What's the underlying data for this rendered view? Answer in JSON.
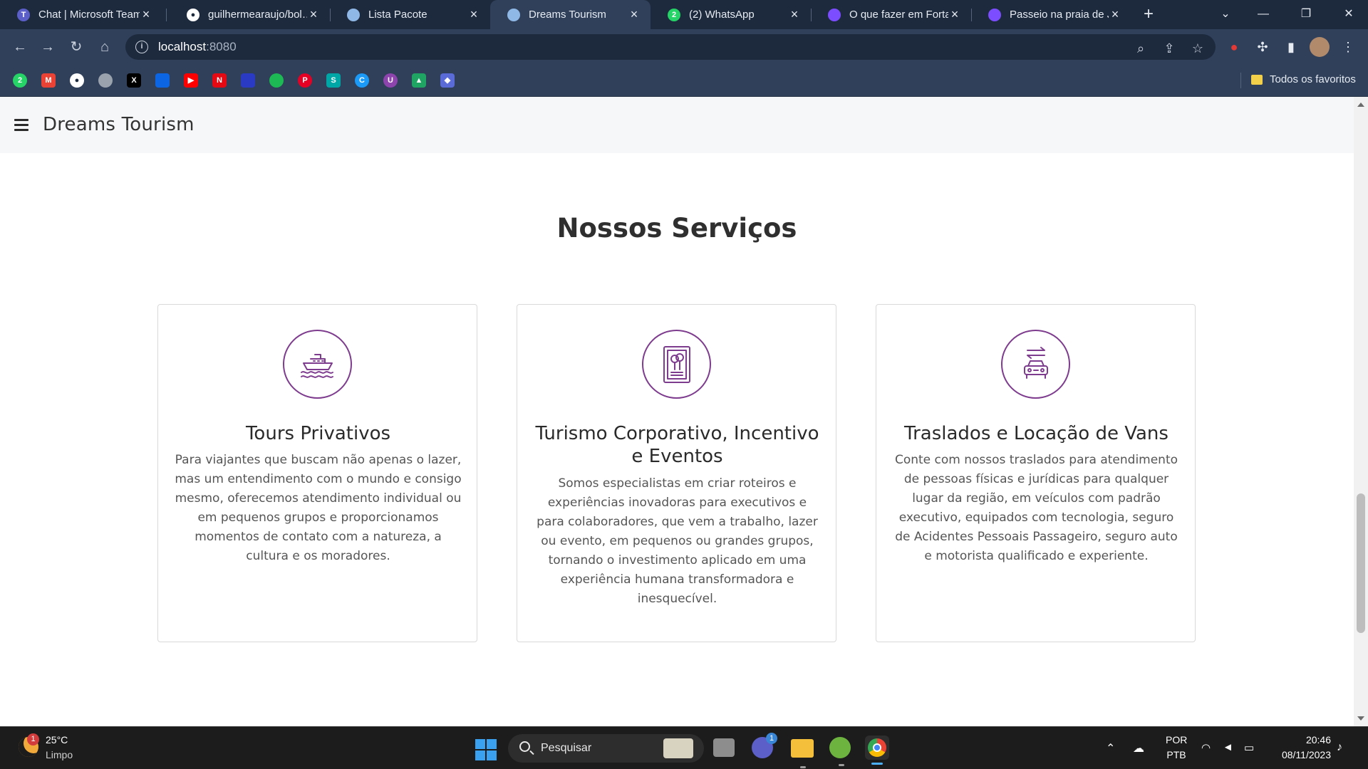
{
  "browser": {
    "tabs": [
      {
        "title": "Chat | Microsoft Teams",
        "favicon": "teams-icon",
        "color": "#5b5fc7",
        "active": false
      },
      {
        "title": "guilhermearaujo/bol…",
        "favicon": "github-icon",
        "color": "#ffffff",
        "active": false
      },
      {
        "title": "Lista Pacote",
        "favicon": "globe-icon",
        "color": "#8fb8e6",
        "active": false
      },
      {
        "title": "Dreams Tourism",
        "favicon": "globe-icon",
        "color": "#8fb8e6",
        "active": true
      },
      {
        "title": "(2) WhatsApp",
        "favicon": "whatsapp-icon",
        "color": "#25d366",
        "active": false
      },
      {
        "title": "O que fazer em Forta…",
        "favicon": "moon-icon",
        "color": "#7c4dff",
        "active": false
      },
      {
        "title": "Passeio na praia de J…",
        "favicon": "moon-icon",
        "color": "#7c4dff",
        "active": false
      }
    ],
    "address": {
      "host": "localhost",
      "port": ":8080"
    },
    "bookmarks_all_label": "Todos os favoritos"
  },
  "page": {
    "brand": "Dreams Tourism",
    "section_title": "Nossos Serviços",
    "services": [
      {
        "icon": "cruise-ship-icon",
        "title": "Tours Privativos",
        "description": "Para viajantes que buscam não apenas o lazer, mas um entendimento com o mundo e consigo mesmo, oferecemos atendimento individual ou em pequenos grupos e proporcionamos momentos de contato com a natureza, a cultura e os moradores."
      },
      {
        "icon": "event-poster-icon",
        "title": "Turismo Corporativo, Incentivo e Eventos",
        "description": "Somos especialistas em criar roteiros e experiências inovadoras para executivos e para colaboradores, que vem a trabalho, lazer ou evento, em pequenos ou grandes grupos, tornando o investimento aplicado em uma experiência humana transformadora e inesquecível."
      },
      {
        "icon": "car-transfer-icon",
        "title": "Traslados e Locação de Vans",
        "description": "Conte com nossos traslados para atendimento de pessoas físicas e jurídicas para qualquer lugar da região, em veículos com padrão executivo, equipados com tecnologia, seguro de Acidentes Pessoais Passageiro, seguro auto e motorista qualificado e experiente."
      }
    ],
    "accent_color": "#7e3c8e"
  },
  "taskbar": {
    "weather": {
      "temp": "25°C",
      "condition": "Limpo",
      "badge": "1"
    },
    "search_placeholder": "Pesquisar",
    "chat_badge": "1",
    "lang": {
      "line1": "POR",
      "line2": "PTB"
    },
    "clock": {
      "time": "20:46",
      "date": "08/11/2023"
    }
  }
}
